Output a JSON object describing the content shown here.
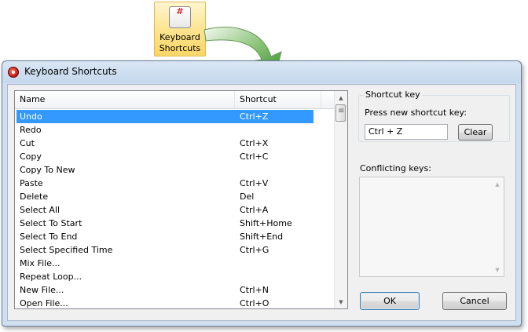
{
  "ribbon": {
    "icon_glyph": "#",
    "label": "Keyboard\nShortcuts"
  },
  "dialog": {
    "title": "Keyboard Shortcuts",
    "list": {
      "columns": [
        "Name",
        "Shortcut"
      ],
      "rows": [
        {
          "name": "Undo",
          "shortcut": "Ctrl+Z",
          "selected": true
        },
        {
          "name": "Redo",
          "shortcut": ""
        },
        {
          "name": "Cut",
          "shortcut": "Ctrl+X"
        },
        {
          "name": "Copy",
          "shortcut": "Ctrl+C"
        },
        {
          "name": "Copy To New",
          "shortcut": ""
        },
        {
          "name": "Paste",
          "shortcut": "Ctrl+V"
        },
        {
          "name": "Delete",
          "shortcut": "Del"
        },
        {
          "name": "Select All",
          "shortcut": "Ctrl+A"
        },
        {
          "name": "Select To Start",
          "shortcut": "Shift+Home"
        },
        {
          "name": "Select To End",
          "shortcut": "Shift+End"
        },
        {
          "name": "Select Specified Time",
          "shortcut": "Ctrl+G"
        },
        {
          "name": "Mix File...",
          "shortcut": ""
        },
        {
          "name": "Repeat Loop...",
          "shortcut": ""
        },
        {
          "name": "New File...",
          "shortcut": "Ctrl+N"
        },
        {
          "name": "Open File...",
          "shortcut": "Ctrl+O"
        }
      ]
    },
    "shortcut_group": {
      "legend": "Shortcut key",
      "prompt": "Press new shortcut key:",
      "value": "Ctrl + Z",
      "clear_label": "Clear"
    },
    "conflicting_label": "Conflicting keys:",
    "ok_label": "OK",
    "cancel_label": "Cancel"
  },
  "colors": {
    "selection": "#3399ff",
    "dialog_frame": "#cfdff0",
    "ribbon_highlight": "#fde38c",
    "arrow_green": "#2f8a2a"
  }
}
